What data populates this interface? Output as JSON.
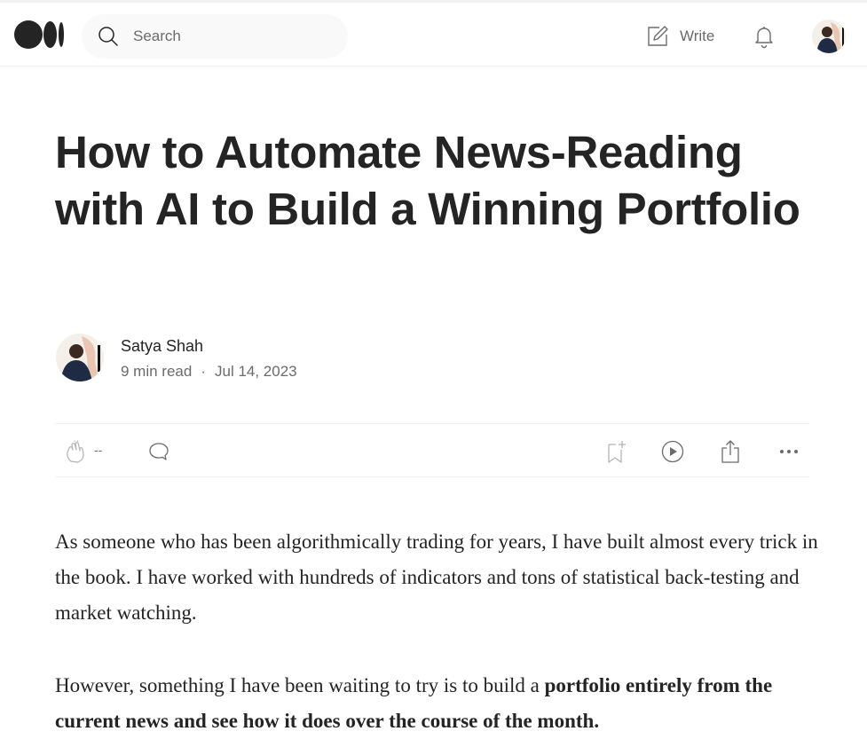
{
  "header": {
    "logo_icon": "medium-logo-icon",
    "search": {
      "placeholder": "Search",
      "value": ""
    },
    "write_label": "Write",
    "notifications_icon": "bell-icon",
    "profile_icon": "user-avatar"
  },
  "article": {
    "title": "How to Automate News-Reading with AI to Build a Winning Portfolio",
    "author": {
      "name": "Satya Shah",
      "read_time": "9 min read",
      "separator": "·",
      "date": "Jul 14, 2023"
    },
    "actions": {
      "clap_count": "--",
      "icons": [
        "clap-icon",
        "comment-icon",
        "bookmark-icon",
        "play-icon",
        "share-icon",
        "more-icon"
      ]
    },
    "paragraphs": {
      "p1": "As someone who has been algorithmically trading for years, I have built almost every trick in the book. I have worked with hundreds of indicators and tons of statistical back-testing and market watching.",
      "p2_plain": "However, something I have been waiting to try is to build a ",
      "p2_bold": "portfolio entirely from the current news and see how it does over the course of the month."
    }
  },
  "colors": {
    "text": "#242424",
    "muted": "#6b6b6b",
    "search_bg": "#f9f9f9",
    "divider": "#f2f2f2"
  }
}
